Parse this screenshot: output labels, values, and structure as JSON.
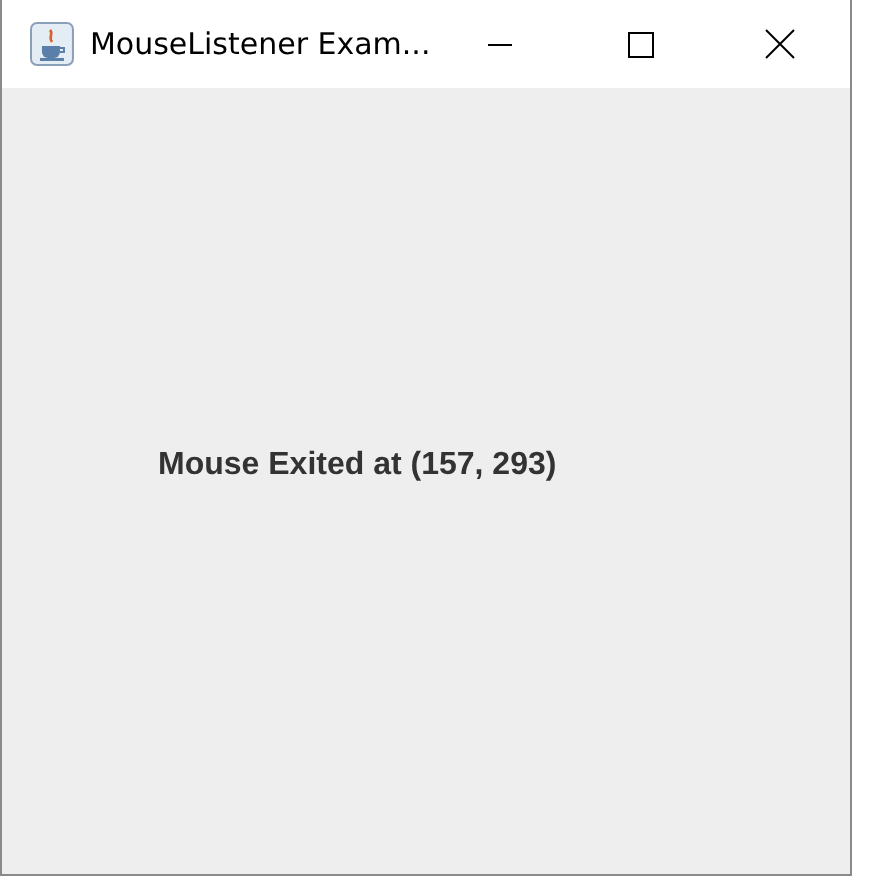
{
  "window": {
    "title": "MouseListener Exam..."
  },
  "label": {
    "text": "Mouse Exited at (157, 293)"
  }
}
